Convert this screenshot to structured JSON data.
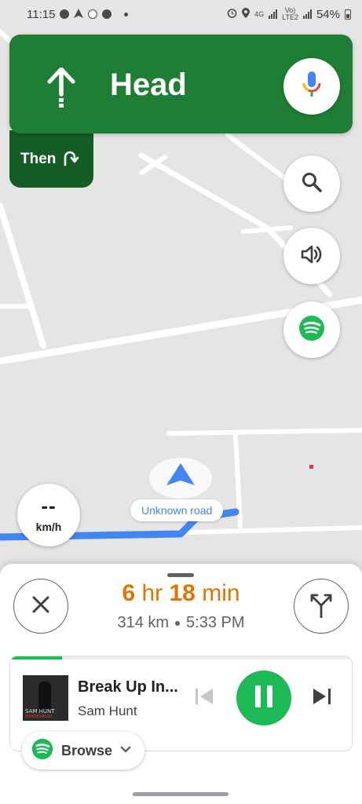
{
  "status_bar": {
    "time": "11:15",
    "network_top": "4G",
    "network_label": "Vo)",
    "network_sub": "LTE2",
    "battery": "54%"
  },
  "navigation": {
    "instruction": "Head",
    "then_label": "Then",
    "accent_color": "#1e7e34",
    "then_color": "#155d27"
  },
  "map": {
    "road_label": "Unknown road",
    "speed_value": "--",
    "speed_unit": "km/h",
    "route_color": "#4285f4"
  },
  "trip": {
    "duration_hours": "6",
    "duration_hours_unit": "hr",
    "duration_minutes": "18",
    "duration_minutes_unit": "min",
    "distance": "314 km",
    "arrival_time": "5:33 PM",
    "eta_color": "#e37400"
  },
  "media": {
    "track_title": "Break Up In...",
    "artist": "Sam Hunt",
    "album_art_artist": "SAM HUNT",
    "album_art_album": "MONTEVALLO",
    "progress": 0.15,
    "accent_color": "#1db954",
    "browse_label": "Browse"
  },
  "icons": {
    "turn": "straight-arrow-icon",
    "then": "turn-right-icon",
    "mic": "mic-icon",
    "search": "search-icon",
    "volume": "volume-icon",
    "spotify": "spotify-icon",
    "close": "close-icon",
    "route": "alternate-routes-icon"
  }
}
